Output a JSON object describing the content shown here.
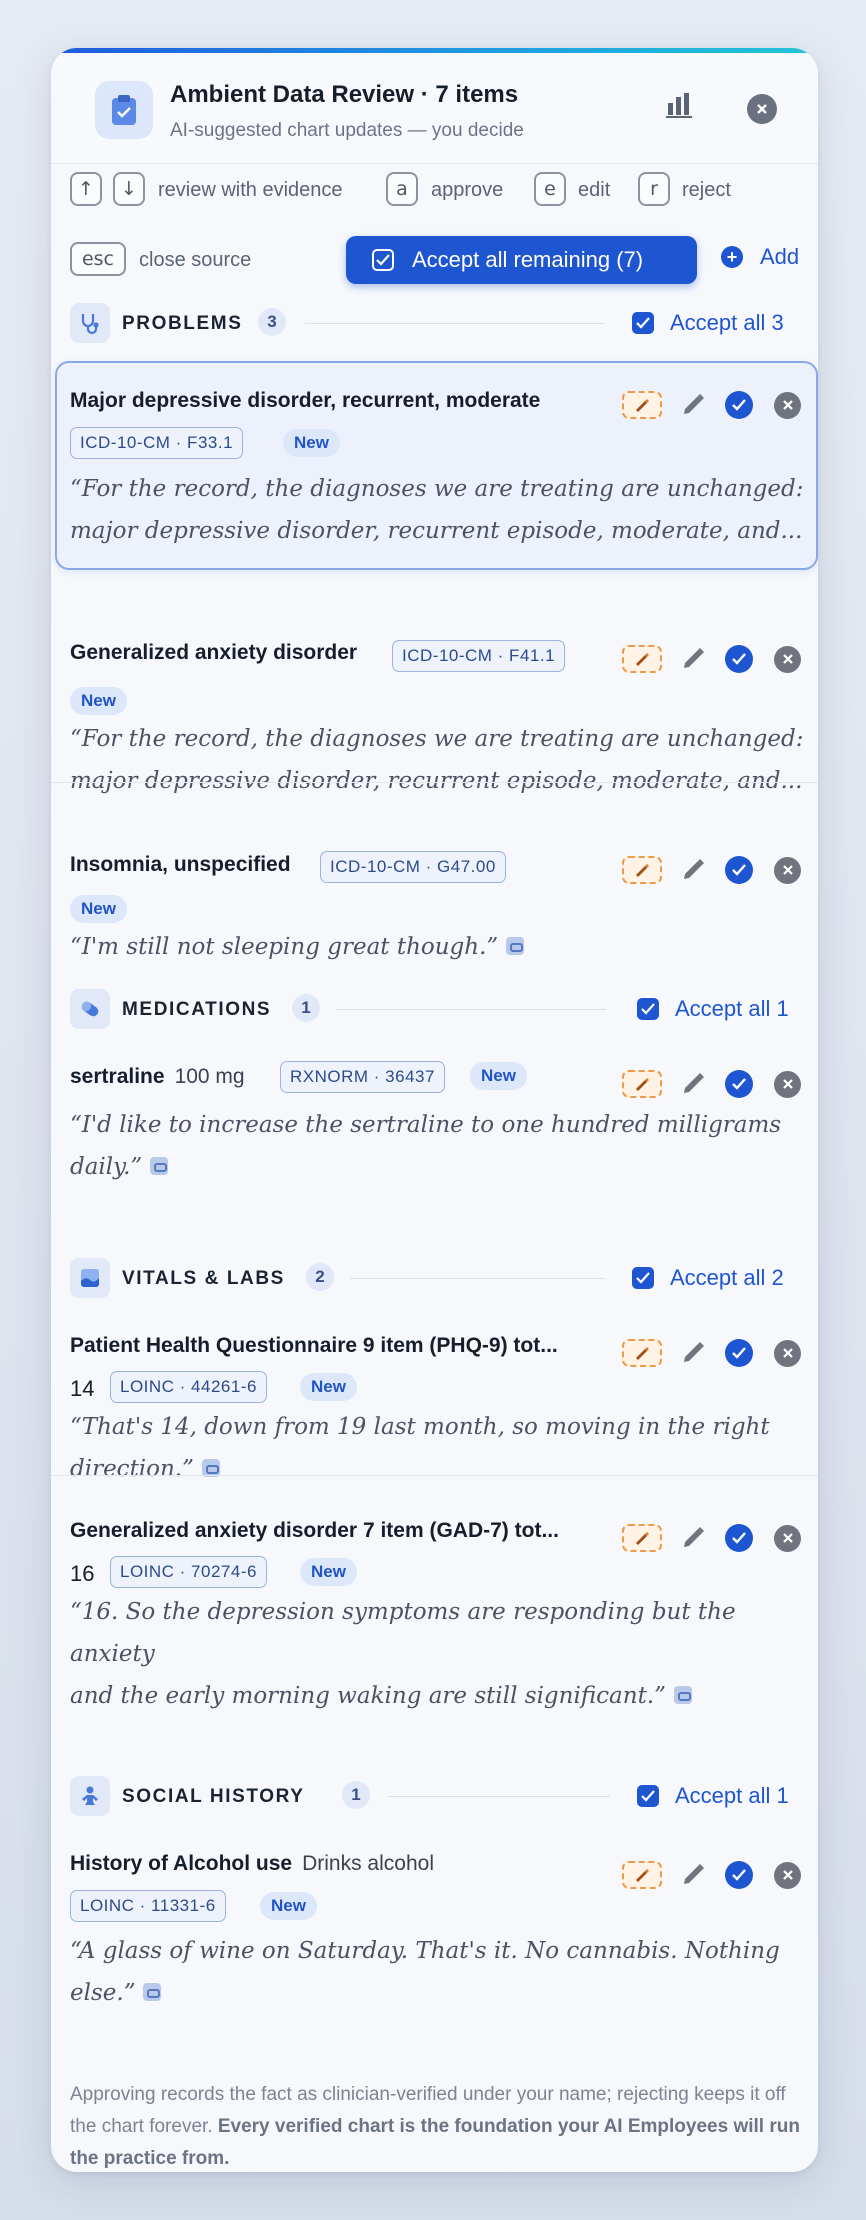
{
  "header": {
    "title": "Ambient Data Review · 7 items",
    "subtitle": "AI-suggested chart updates — you decide",
    "icon": "clipboard-check-icon",
    "chart_icon": "bar-chart-icon",
    "close_icon": "close-icon"
  },
  "shortcuts": {
    "up_key": "↑",
    "down_key": "↓",
    "review_label": "review with evidence",
    "approve_key": "a",
    "approve_label": "approve",
    "edit_key": "e",
    "edit_label": "edit",
    "reject_key": "r",
    "reject_label": "reject",
    "esc_key": "esc",
    "esc_label": "close source"
  },
  "toolbar": {
    "accept_remaining_label": "Accept all remaining (7)",
    "add_label": "Add"
  },
  "colors": {
    "accent": "#1e55d0",
    "new_badge_bg": "#dde7fa",
    "code_badge_border": "#9bb2de",
    "eraser_orange": "#ee9a4a",
    "reject_grey": "#70747e"
  },
  "sections": {
    "problems": {
      "title": "PROBLEMS",
      "count": "3",
      "accept_label": "Accept all 3",
      "icon": "stethoscope-icon",
      "items": [
        {
          "title": "Major depressive disorder, recurrent, moderate",
          "code": "ICD-10-CM · F33.1",
          "badge": "New",
          "quote_l1": "“For the record, the diagnoses we are treating are unchanged:",
          "quote_l2": "major depressive disorder, recurrent episode, moderate, and..."
        },
        {
          "title": "Generalized anxiety disorder",
          "code": "ICD-10-CM · F41.1",
          "badge": "New",
          "quote_l1": "“For the record, the diagnoses we are treating are unchanged:",
          "quote_l2": "major depressive disorder, recurrent episode, moderate, and..."
        },
        {
          "title": "Insomnia, unspecified",
          "code": "ICD-10-CM · G47.00",
          "badge": "New",
          "quote_l1": "“I'm still not sleeping great though.”"
        }
      ]
    },
    "medications": {
      "title": "MEDICATIONS",
      "count": "1",
      "accept_label": "Accept all 1",
      "icon": "pill-icon",
      "items": [
        {
          "title": "sertraline",
          "detail": "100 mg",
          "code": "RXNORM · 36437",
          "badge": "New",
          "quote_l1": "“I'd like to increase the sertraline to one hundred milligrams",
          "quote_l2": "daily.”"
        }
      ]
    },
    "vitals": {
      "title": "VITALS & LABS",
      "count": "2",
      "accept_label": "Accept all 2",
      "icon": "lab-flask-icon",
      "items": [
        {
          "title": "Patient Health Questionnaire 9 item (PHQ-9) tot...",
          "value": "14",
          "code": "LOINC · 44261-6",
          "badge": "New",
          "quote_l1": "“That's 14, down from 19 last month, so moving in the right",
          "quote_l2": "direction.”"
        },
        {
          "title": "Generalized anxiety disorder 7 item (GAD-7) tot...",
          "value": "16",
          "code": "LOINC · 70274-6",
          "badge": "New",
          "quote_l1": "“16. So the depression symptoms are responding but the anxiety",
          "quote_l2": "and the early morning waking are still significant.”"
        }
      ]
    },
    "social": {
      "title": "SOCIAL HISTORY",
      "count": "1",
      "accept_label": "Accept all 1",
      "icon": "person-icon",
      "items": [
        {
          "title": "History of Alcohol use",
          "detail": "Drinks alcohol",
          "code": "LOINC · 11331-6",
          "badge": "New",
          "quote_l1": "“A glass of wine on Saturday. That's it. No cannabis. Nothing",
          "quote_l2": "else.”"
        }
      ]
    }
  },
  "footer": {
    "text": "Approving records the fact as clinician-verified under your name; rejecting keeps it off the chart forever.",
    "bold": "Every verified chart is the foundation your AI Employees will run the practice from."
  }
}
